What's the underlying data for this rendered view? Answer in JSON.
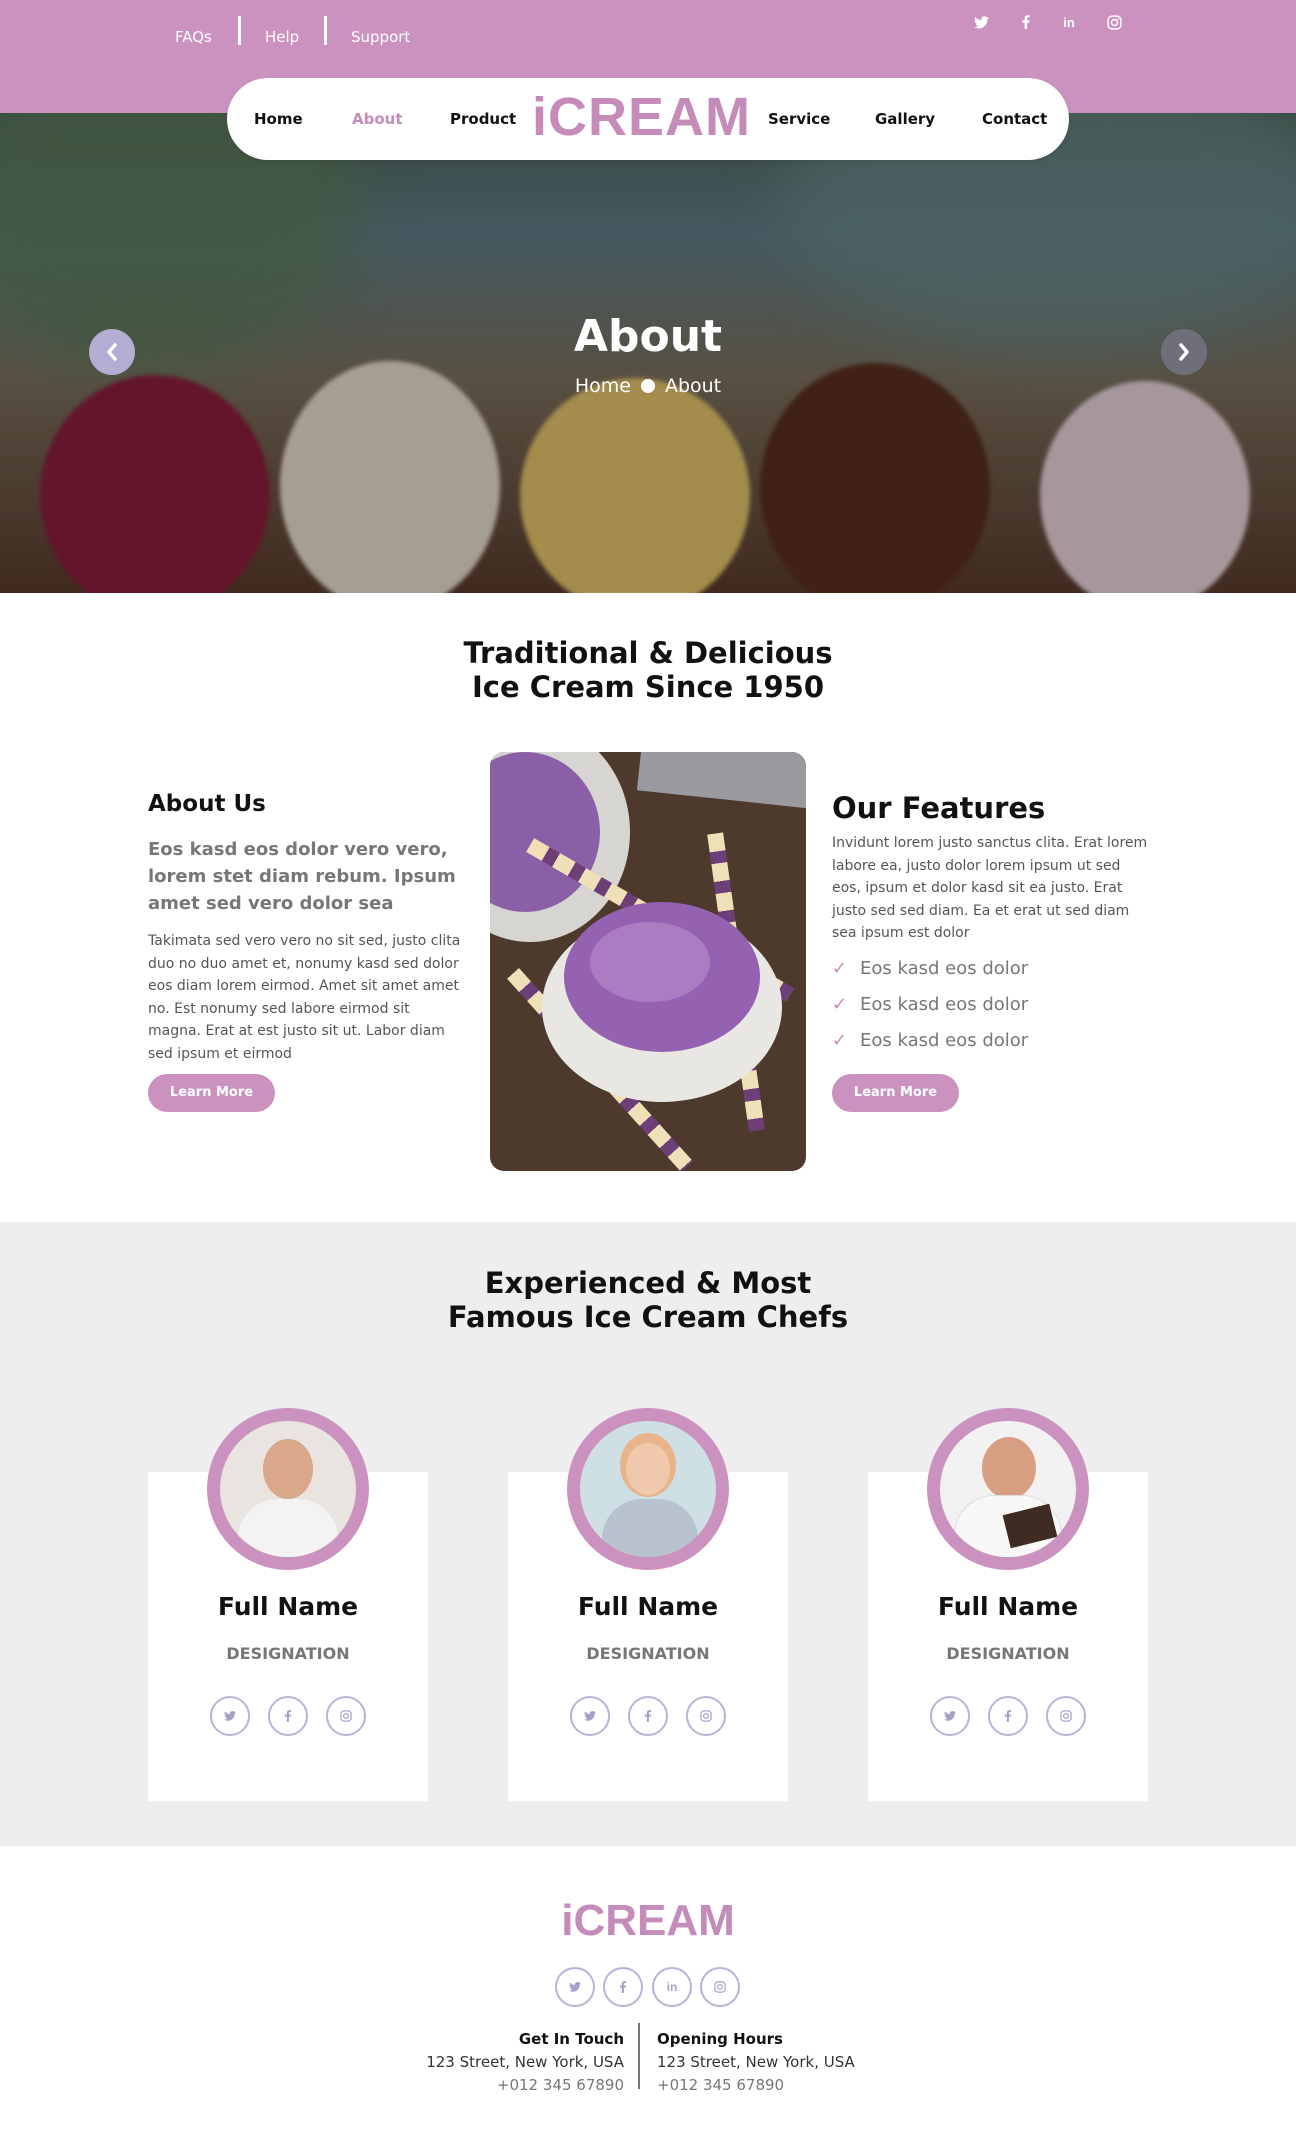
{
  "colors": {
    "brand": "#cc92bf",
    "brand_text": "#c58bb9",
    "social": "#a89fcb"
  },
  "topbar": {
    "links": [
      "FAQs",
      "Help",
      "Support"
    ],
    "social_icons": [
      "twitter-icon",
      "facebook-icon",
      "linkedin-icon",
      "instagram-icon"
    ]
  },
  "nav": {
    "items": [
      "Home",
      "About",
      "Product",
      "Service",
      "Gallery",
      "Contact"
    ],
    "active": "About",
    "logo": "iCREAM"
  },
  "hero": {
    "title": "About",
    "crumb_home": "Home",
    "crumb_current": "About",
    "prev_icon": "chevron-left-icon",
    "next_icon": "chevron-right-icon"
  },
  "intro": {
    "title_line1": "Traditional & Delicious",
    "title_line2": "Ice Cream Since 1950"
  },
  "about": {
    "heading": "About Us",
    "lead": "Eos kasd eos dolor vero vero, lorem stet diam rebum. Ipsum amet sed vero dolor sea",
    "body": "Takimata sed vero vero no sit sed, justo clita duo no duo amet et, nonumy kasd sed dolor eos diam lorem eirmod. Amet sit amet amet no. Est nonumy sed labore eirmod sit magna. Erat at est justo sit ut. Labor diam sed ipsum et eirmod",
    "button": "Learn More"
  },
  "features": {
    "heading": "Our Features",
    "body": "Invidunt lorem justo sanctus clita. Erat lorem labore ea, justo dolor lorem ipsum ut sed eos, ipsum et dolor kasd sit ea justo. Erat justo sed sed diam. Ea et erat ut sed diam sea ipsum est dolor",
    "items": [
      "Eos kasd eos dolor",
      "Eos kasd eos dolor",
      "Eos kasd eos dolor"
    ],
    "button": "Learn More"
  },
  "team": {
    "title_line1": "Experienced & Most",
    "title_line2": "Famous Ice Cream Chefs",
    "members": [
      {
        "name": "Full Name",
        "designation": "DESIGNATION"
      },
      {
        "name": "Full Name",
        "designation": "DESIGNATION"
      },
      {
        "name": "Full Name",
        "designation": "DESIGNATION"
      }
    ]
  },
  "footer": {
    "logo": "iCREAM",
    "touch": {
      "heading": "Get In Touch",
      "address": "123 Street, New York, USA",
      "phone": "+012 345 67890"
    },
    "hours": {
      "heading": "Opening Hours",
      "address": "123 Street, New York, USA",
      "phone": "+012 345 67890"
    }
  }
}
